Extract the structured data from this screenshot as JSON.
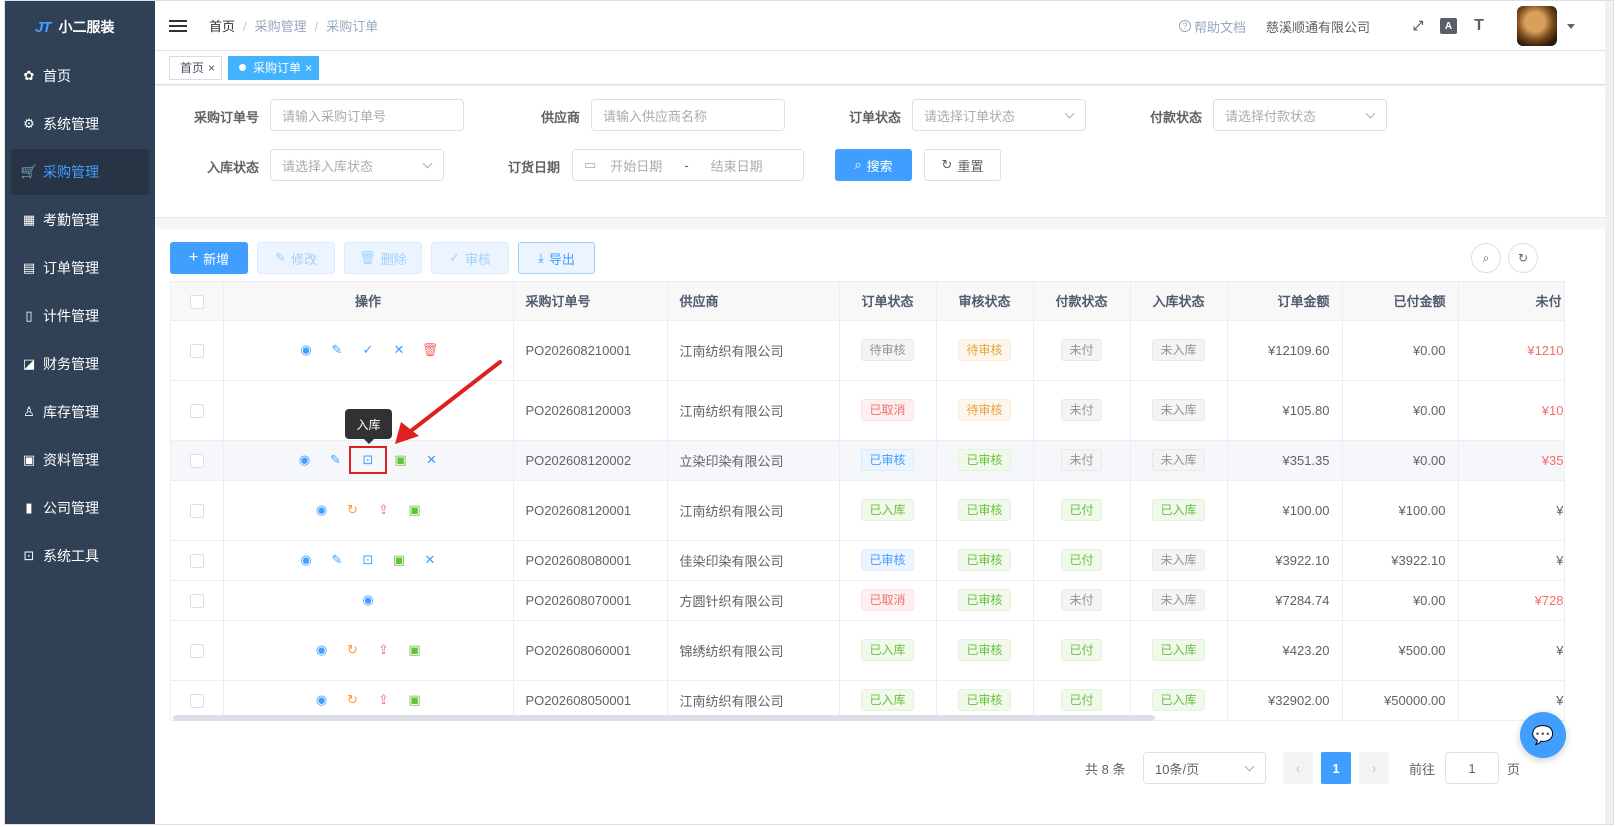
{
  "app": {
    "logo_mark": "JT",
    "name": "小二服装"
  },
  "sidebar": {
    "items": [
      {
        "label": "首页",
        "icon": "dashboard-icon",
        "glyph": "✿",
        "active": false
      },
      {
        "label": "系统管理",
        "icon": "gear-icon",
        "glyph": "⚙",
        "active": false
      },
      {
        "label": "采购管理",
        "icon": "cart-icon",
        "glyph": "🛒",
        "active": true
      },
      {
        "label": "考勤管理",
        "icon": "grid-icon",
        "glyph": "▦",
        "active": false
      },
      {
        "label": "订单管理",
        "icon": "order-icon",
        "glyph": "▤",
        "active": false
      },
      {
        "label": "计件管理",
        "icon": "book-icon",
        "glyph": "▯",
        "active": false
      },
      {
        "label": "财务管理",
        "icon": "finance-chart-icon",
        "glyph": "◪",
        "active": false
      },
      {
        "label": "库存管理",
        "icon": "user-icon",
        "glyph": "♙",
        "active": false
      },
      {
        "label": "资料管理",
        "icon": "document-icon",
        "glyph": "▣",
        "active": false
      },
      {
        "label": "公司管理",
        "icon": "bar-chart-icon",
        "glyph": "▮",
        "active": false
      },
      {
        "label": "系统工具",
        "icon": "toolbox-icon",
        "glyph": "⊡",
        "active": false
      }
    ]
  },
  "header": {
    "breadcrumb": [
      "首页",
      "采购管理",
      "采购订单"
    ],
    "help_label": "帮助文档",
    "company": "慈溪顺通有限公司"
  },
  "tags": [
    {
      "label": "首页",
      "active": false
    },
    {
      "label": "采购订单",
      "active": true
    }
  ],
  "search": {
    "order_no_label": "采购订单号",
    "order_no_placeholder": "请输入采购订单号",
    "supplier_label": "供应商",
    "supplier_placeholder": "请输入供应商名称",
    "order_status_label": "订单状态",
    "order_status_placeholder": "请选择订单状态",
    "pay_status_label": "付款状态",
    "pay_status_placeholder": "请选择付款状态",
    "stock_status_label": "入库状态",
    "stock_status_placeholder": "请选择入库状态",
    "date_label": "订货日期",
    "start_placeholder": "开始日期",
    "date_sep": "-",
    "end_placeholder": "结束日期",
    "search_button": "搜索",
    "reset_button": "重置"
  },
  "toolbar": {
    "add": "新增",
    "edit": "修改",
    "delete": "删除",
    "audit": "审核",
    "export": "导出"
  },
  "table": {
    "columns": [
      "操作",
      "采购订单号",
      "供应商",
      "订单状态",
      "审核状态",
      "付款状态",
      "入库状态",
      "订单金额",
      "已付金额",
      "未付"
    ],
    "rows": [
      {
        "order_no": "PO202608210001",
        "supplier": "江南纺织有限公司",
        "order_status": "待审核",
        "os_type": "info",
        "audit": "待审核",
        "au_type": "warn",
        "pay": "未付",
        "pay_type": "info",
        "stock": "未入库",
        "st_type": "info",
        "amount": "¥12109.60",
        "paid": "¥0.00",
        "unpaid": "¥1210",
        "unpaid_red": true,
        "ops": [
          "view",
          "edit",
          "check",
          "close",
          "delete"
        ]
      },
      {
        "order_no": "PO202608120003",
        "supplier": "江南纺织有限公司",
        "order_status": "已取消",
        "os_type": "danger",
        "audit": "待审核",
        "au_type": "warn",
        "pay": "未付",
        "pay_type": "info",
        "stock": "未入库",
        "st_type": "info",
        "amount": "¥105.80",
        "paid": "¥0.00",
        "unpaid": "¥10",
        "unpaid_red": true,
        "ops": []
      },
      {
        "order_no": "PO202608120002",
        "supplier": "立染印染有限公司",
        "order_status": "已审核",
        "os_type": "primary",
        "audit": "已审核",
        "au_type": "success",
        "pay": "未付",
        "pay_type": "info",
        "stock": "未入库",
        "st_type": "info",
        "amount": "¥351.35",
        "paid": "¥0.00",
        "unpaid": "¥35",
        "unpaid_red": true,
        "ops": [
          "view",
          "edit",
          "stock-in",
          "pay",
          "close"
        ]
      },
      {
        "order_no": "PO202608120001",
        "supplier": "江南纺织有限公司",
        "order_status": "已入库",
        "os_type": "success",
        "audit": "已审核",
        "au_type": "success",
        "pay": "已付",
        "pay_type": "success",
        "stock": "已入库",
        "st_type": "success",
        "amount": "¥100.00",
        "paid": "¥100.00",
        "unpaid": "¥",
        "unpaid_red": false,
        "ops": [
          "view",
          "revert",
          "return",
          "pay"
        ]
      },
      {
        "order_no": "PO202608080001",
        "supplier": "佳染印染有限公司",
        "order_status": "已审核",
        "os_type": "primary",
        "audit": "已审核",
        "au_type": "success",
        "pay": "已付",
        "pay_type": "success",
        "stock": "未入库",
        "st_type": "info",
        "amount": "¥3922.10",
        "paid": "¥3922.10",
        "unpaid": "¥",
        "unpaid_red": false,
        "ops": [
          "view",
          "edit",
          "stock-in",
          "pay",
          "close"
        ]
      },
      {
        "order_no": "PO202608070001",
        "supplier": "方圆针织有限公司",
        "order_status": "已取消",
        "os_type": "danger",
        "audit": "已审核",
        "au_type": "success",
        "pay": "未付",
        "pay_type": "info",
        "stock": "未入库",
        "st_type": "info",
        "amount": "¥7284.74",
        "paid": "¥0.00",
        "unpaid": "¥728",
        "unpaid_red": true,
        "ops": [
          "view"
        ]
      },
      {
        "order_no": "PO202608060001",
        "supplier": "锦绣纺织有限公司",
        "order_status": "已入库",
        "os_type": "success",
        "audit": "已审核",
        "au_type": "success",
        "pay": "已付",
        "pay_type": "success",
        "stock": "已入库",
        "st_type": "success",
        "amount": "¥423.20",
        "paid": "¥500.00",
        "unpaid": "¥",
        "unpaid_red": false,
        "ops": [
          "view",
          "revert",
          "return",
          "pay"
        ]
      },
      {
        "order_no": "PO202608050001",
        "supplier": "江南纺织有限公司",
        "order_status": "已入库",
        "os_type": "success",
        "audit": "已审核",
        "au_type": "success",
        "pay": "已付",
        "pay_type": "success",
        "stock": "已入库",
        "st_type": "success",
        "amount": "¥32902.00",
        "paid": "¥50000.00",
        "unpaid": "¥",
        "unpaid_red": false,
        "ops": [
          "view",
          "revert",
          "return",
          "pay"
        ]
      }
    ]
  },
  "tooltip": "入库",
  "pagination": {
    "total": "共 8 条",
    "page_size": "10条/页",
    "current": "1",
    "goto_label": "前往",
    "goto_value": "1",
    "page_suffix": "页"
  },
  "colors": {
    "primary": "#409eff",
    "sidebar_bg": "#304156",
    "annotation_red": "#e02020"
  }
}
